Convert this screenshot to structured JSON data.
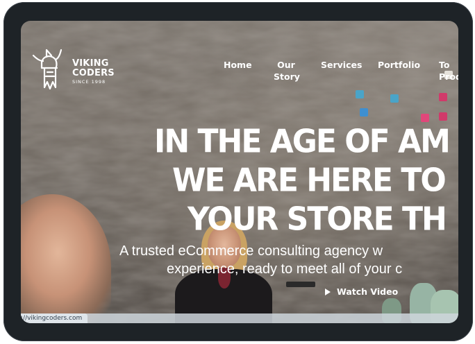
{
  "brand": {
    "name_line1": "VIKING",
    "name_line2": "CODERS",
    "since": "SINCE 1998"
  },
  "nav": {
    "items": [
      {
        "label": "Home"
      },
      {
        "label": "Our\nStory"
      },
      {
        "label": "Services"
      },
      {
        "label": "Portfolio"
      },
      {
        "label": "To\nProd"
      }
    ]
  },
  "hero": {
    "headline_lines": [
      "IN THE AGE OF AM",
      "WE ARE HERE TO",
      "YOUR STORE TH"
    ],
    "subtitle_lines": [
      "A trusted eCommerce consulting agency w",
      "experience, ready to meet all of your c"
    ],
    "watch_label": "Watch Video"
  },
  "status_bar": {
    "url": "://vikingcoders.com"
  },
  "icons": {
    "logo": "viking-helmet-icon",
    "play": "play-icon"
  },
  "colors": {
    "device_frame": "#1e2327",
    "text": "#ffffff",
    "status_bar": "#dfe5ea"
  }
}
